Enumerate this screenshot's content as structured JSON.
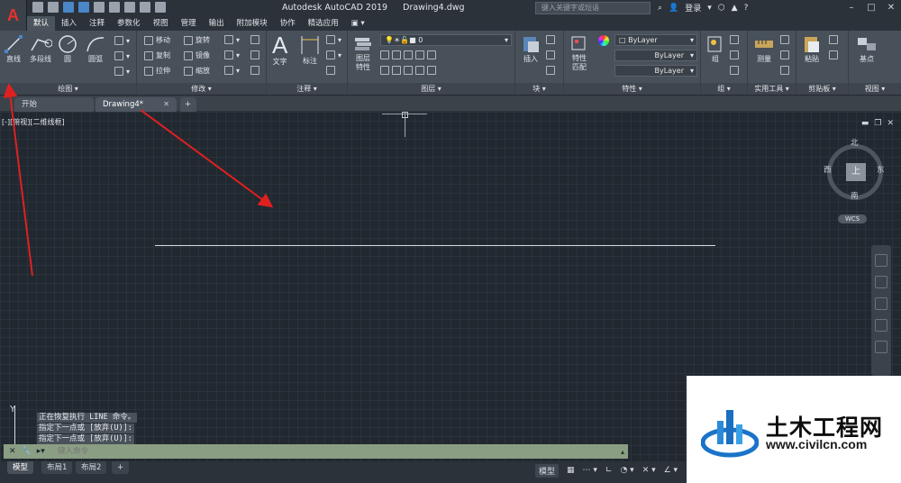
{
  "app": {
    "logo": "A",
    "title": "Autodesk AutoCAD 2019",
    "file": "Drawing4.dwg"
  },
  "search": {
    "placeholder": "键入关键字或短语"
  },
  "user": {
    "login": "登录"
  },
  "ribbon_tabs": [
    "默认",
    "插入",
    "注释",
    "参数化",
    "视图",
    "管理",
    "输出",
    "附加模块",
    "协作",
    "精选应用"
  ],
  "ribbon": {
    "draw": {
      "title": "绘图",
      "line": "直线",
      "polyline": "多段线",
      "circle": "圆",
      "arc": "圆弧"
    },
    "modify": {
      "title": "修改",
      "move": "移动",
      "rotate": "旋转",
      "copy": "复制",
      "mirror": "镜像",
      "stretch": "拉伸",
      "scale": "缩放"
    },
    "annotation": {
      "title": "注释",
      "text": "文字",
      "dimension": "标注"
    },
    "layers": {
      "title": "图层",
      "properties": "图层\n特性",
      "layer_value": "0"
    },
    "block": {
      "title": "块",
      "insert": "插入"
    },
    "properties": {
      "title": "特性",
      "match": "特性\n匹配",
      "color": "ByLayer",
      "linetype": "ByLayer",
      "lineweight": "ByLayer"
    },
    "groups": {
      "title": "组",
      "group": "组"
    },
    "utilities": {
      "title": "实用工具",
      "measure": "测量"
    },
    "clipboard": {
      "title": "剪贴板",
      "paste": "粘贴"
    },
    "view": {
      "title": "视图",
      "base": "基点"
    }
  },
  "file_tabs": {
    "start": "开始",
    "drawing": "Drawing4*",
    "add": "+"
  },
  "viewport": {
    "label": "[-][俯视][二维线框]"
  },
  "viewcube": {
    "top": "上",
    "north": "北",
    "south": "南",
    "east": "东",
    "west": "西",
    "wcs": "WCS"
  },
  "ucs": {
    "y": "Y"
  },
  "command": {
    "history": [
      "正在恢复执行 LINE 命令。",
      "指定下一点或 [放弃(U)]:",
      "指定下一点或 [放弃(U)]:"
    ],
    "placeholder": "键入命令"
  },
  "layout_tabs": [
    "模型",
    "布局1",
    "布局2",
    "+"
  ],
  "status": {
    "model": "模型"
  },
  "watermark": {
    "name": "土木工程网",
    "url": "www.civilcn.com"
  },
  "colors": {
    "accent": "#e8312c",
    "background": "#212830",
    "arrow": "#e02020"
  }
}
